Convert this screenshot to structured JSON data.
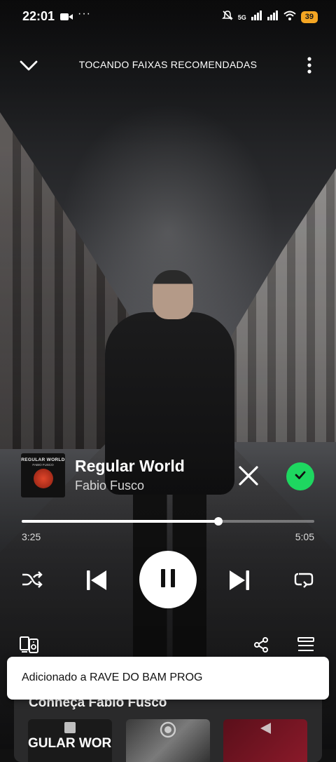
{
  "status_bar": {
    "time": "22:01",
    "dots": "···",
    "network": "5G",
    "battery": "39"
  },
  "top_bar": {
    "context_title": "TOCANDO FAIXAS RECOMENDADAS"
  },
  "track": {
    "cover_title": "REGULAR WORLD",
    "cover_artist": "FABIO FUSCO",
    "title": "Regular World",
    "artist": "Fabio Fusco",
    "liked": true
  },
  "playback": {
    "elapsed": "3:25",
    "duration": "5:05",
    "progress_fraction": 0.6722,
    "state": "playing"
  },
  "icons": {
    "collapse": "chevron-down-icon",
    "more": "more-vertical-icon",
    "remove": "close-icon",
    "liked": "check-icon",
    "shuffle": "shuffle-icon",
    "previous": "skip-previous-icon",
    "pause": "pause-icon",
    "next": "skip-next-icon",
    "repeat": "repeat-icon",
    "devices": "devices-icon",
    "share": "share-icon",
    "queue": "queue-icon"
  },
  "colors": {
    "accent": "#1ed760",
    "battery": "#f5a623"
  },
  "panel": {
    "title": "Conheça Fabio Fusco",
    "thumbnails": [
      {
        "label": "GULAR WOR",
        "icon": "stop-icon"
      },
      {
        "label": "",
        "icon": "record-icon"
      },
      {
        "label": "",
        "icon": "play-back-icon"
      }
    ]
  },
  "snackbar": {
    "message": "Adicionado a RAVE DO BAM PROG"
  }
}
